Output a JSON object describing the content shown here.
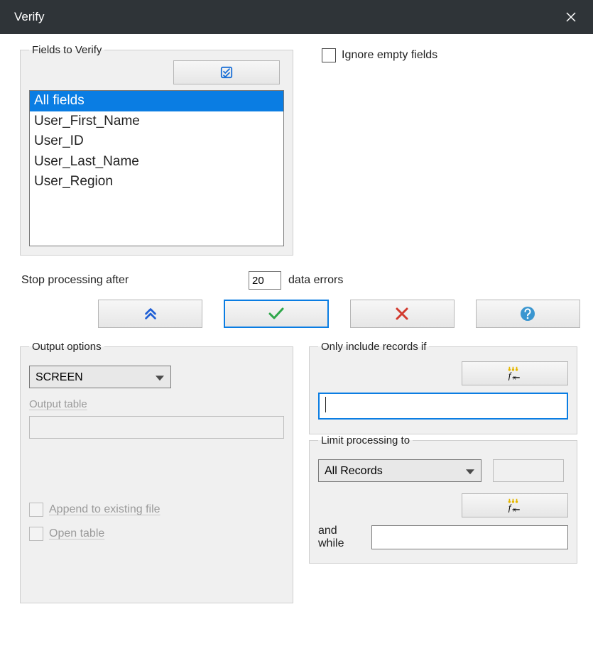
{
  "window": {
    "title": "Verify"
  },
  "fields": {
    "legend": "Fields to Verify",
    "items": [
      {
        "label": "All fields",
        "selected": true
      },
      {
        "label": "User_First_Name",
        "selected": false
      },
      {
        "label": "User_ID",
        "selected": false
      },
      {
        "label": "User_Last_Name",
        "selected": false
      },
      {
        "label": "User_Region",
        "selected": false
      }
    ]
  },
  "ignore_empty": {
    "label": "Ignore empty fields",
    "checked": false
  },
  "stop": {
    "before": "Stop processing after",
    "value": "20",
    "after": "data errors"
  },
  "output": {
    "legend": "Output options",
    "destination": "SCREEN",
    "output_table_label": "Output table",
    "output_table_value": "",
    "append_label": "Append to existing file",
    "append_checked": false,
    "open_label": "Open table",
    "open_checked": false
  },
  "include": {
    "legend": "Only include records if",
    "expr": ""
  },
  "limit": {
    "legend": "Limit processing to",
    "scope": "All Records",
    "n": "",
    "andwhile_label": "and while",
    "andwhile_expr": ""
  }
}
